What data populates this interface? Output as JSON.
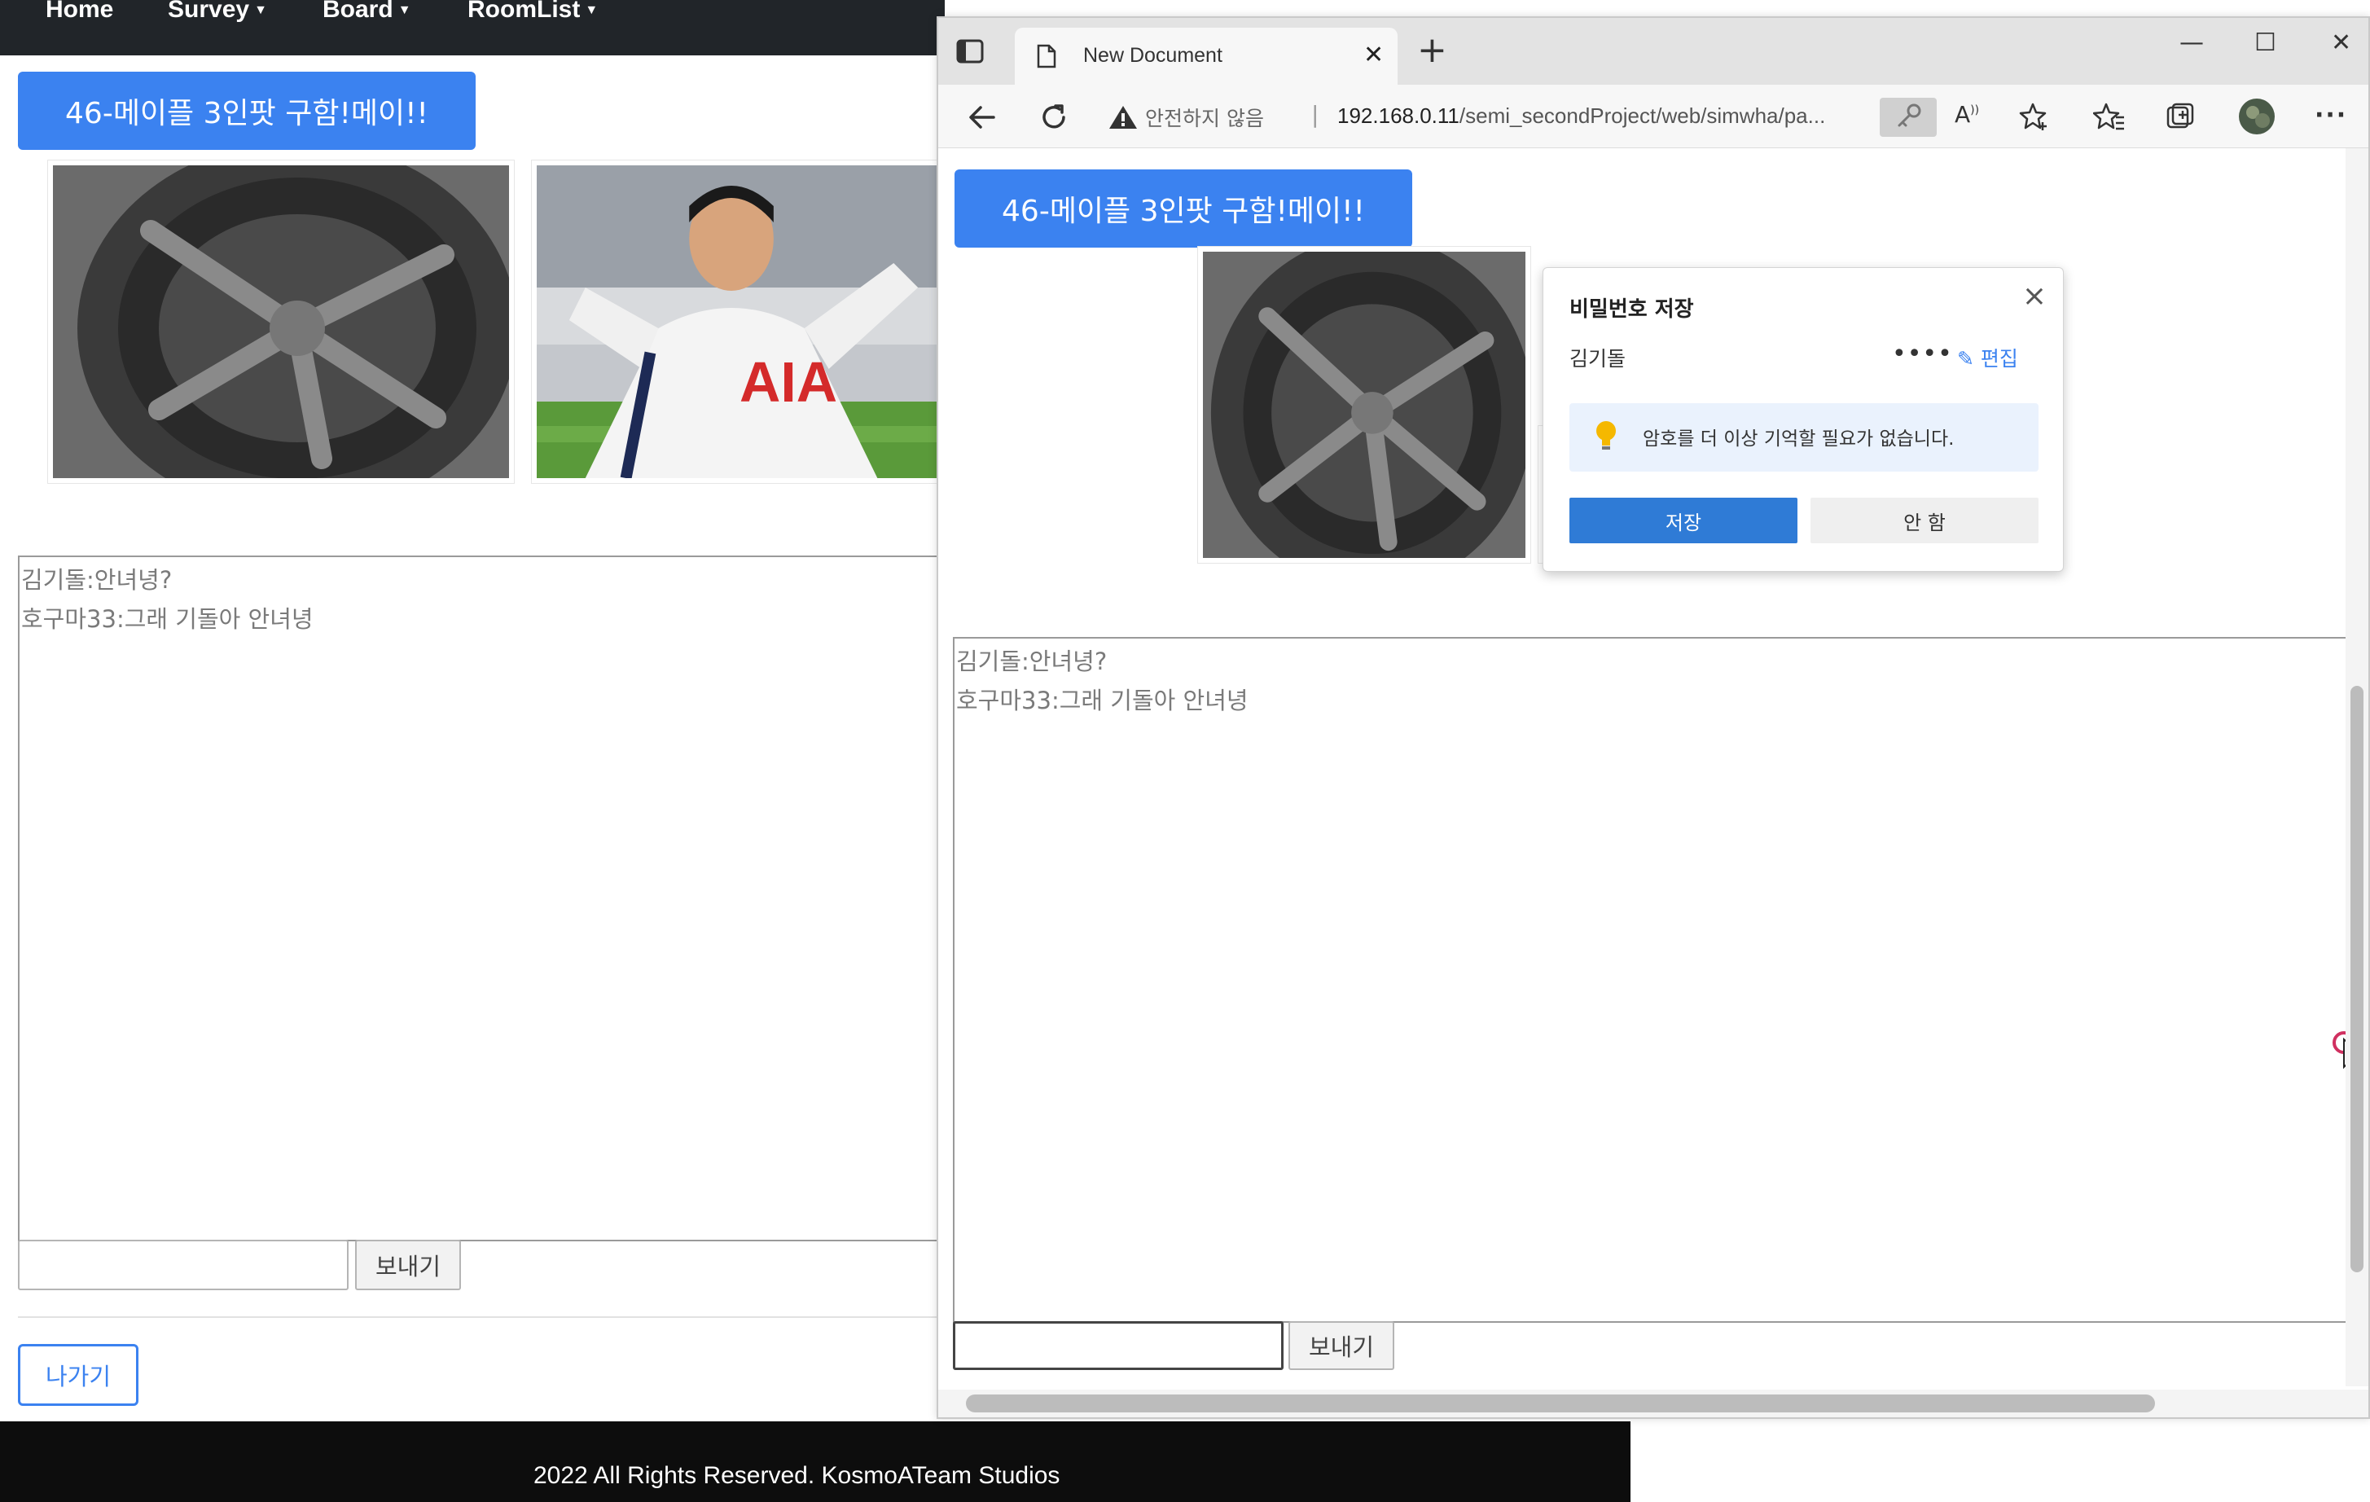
{
  "left_page": {
    "nav": [
      {
        "label": "Home",
        "dropdown": false
      },
      {
        "label": "Survey",
        "dropdown": true
      },
      {
        "label": "Board",
        "dropdown": true
      },
      {
        "label": "RoomList",
        "dropdown": true
      }
    ],
    "room_title": "46-메이플 3인팟 구함!메이!!",
    "chat_lines": [
      "김기돌:안녀녕?",
      "호구마33:그래 기돌아 안녀녕"
    ],
    "send_label": "보내기",
    "exit_label": "나가기",
    "footer": "2022 All Rights Reserved. KosmoATeam Studios"
  },
  "browser": {
    "tab_title": "New Document",
    "address": {
      "security_label": "안전하지 않음",
      "host": "192.168.0.11",
      "path": "/semi_secondProject/web/simwha/pa..."
    },
    "room_title": "46-메이플 3인팟 구함!메이!!",
    "chat_lines": [
      "김기돌:안녀녕?",
      "호구마33:그래 기돌아 안녀녕"
    ],
    "send_label": "보내기",
    "password_popup": {
      "title": "비밀번호 저장",
      "username": "김기돌",
      "password_mask": "••••",
      "edit_label": "편집",
      "info_text": "암호를 더 이상 기억할 필요가 없습니다.",
      "save_label": "저장",
      "cancel_label": "안 함"
    }
  },
  "colors": {
    "accent_blue": "#3b82f0",
    "nav_dark": "#212529",
    "footer_black": "#0d0d0d",
    "popup_save_blue": "#2f7bd6"
  },
  "icons": [
    "tab-actions-icon",
    "document-icon",
    "close-icon",
    "plus-icon",
    "minimize-icon",
    "maximize-icon",
    "back-arrow-icon",
    "refresh-icon",
    "warning-icon",
    "key-icon",
    "read-aloud-icon",
    "add-favorite-icon",
    "favorites-icon",
    "collections-icon",
    "profile-avatar-icon",
    "more-icon",
    "lightbulb-icon",
    "pencil-icon"
  ]
}
